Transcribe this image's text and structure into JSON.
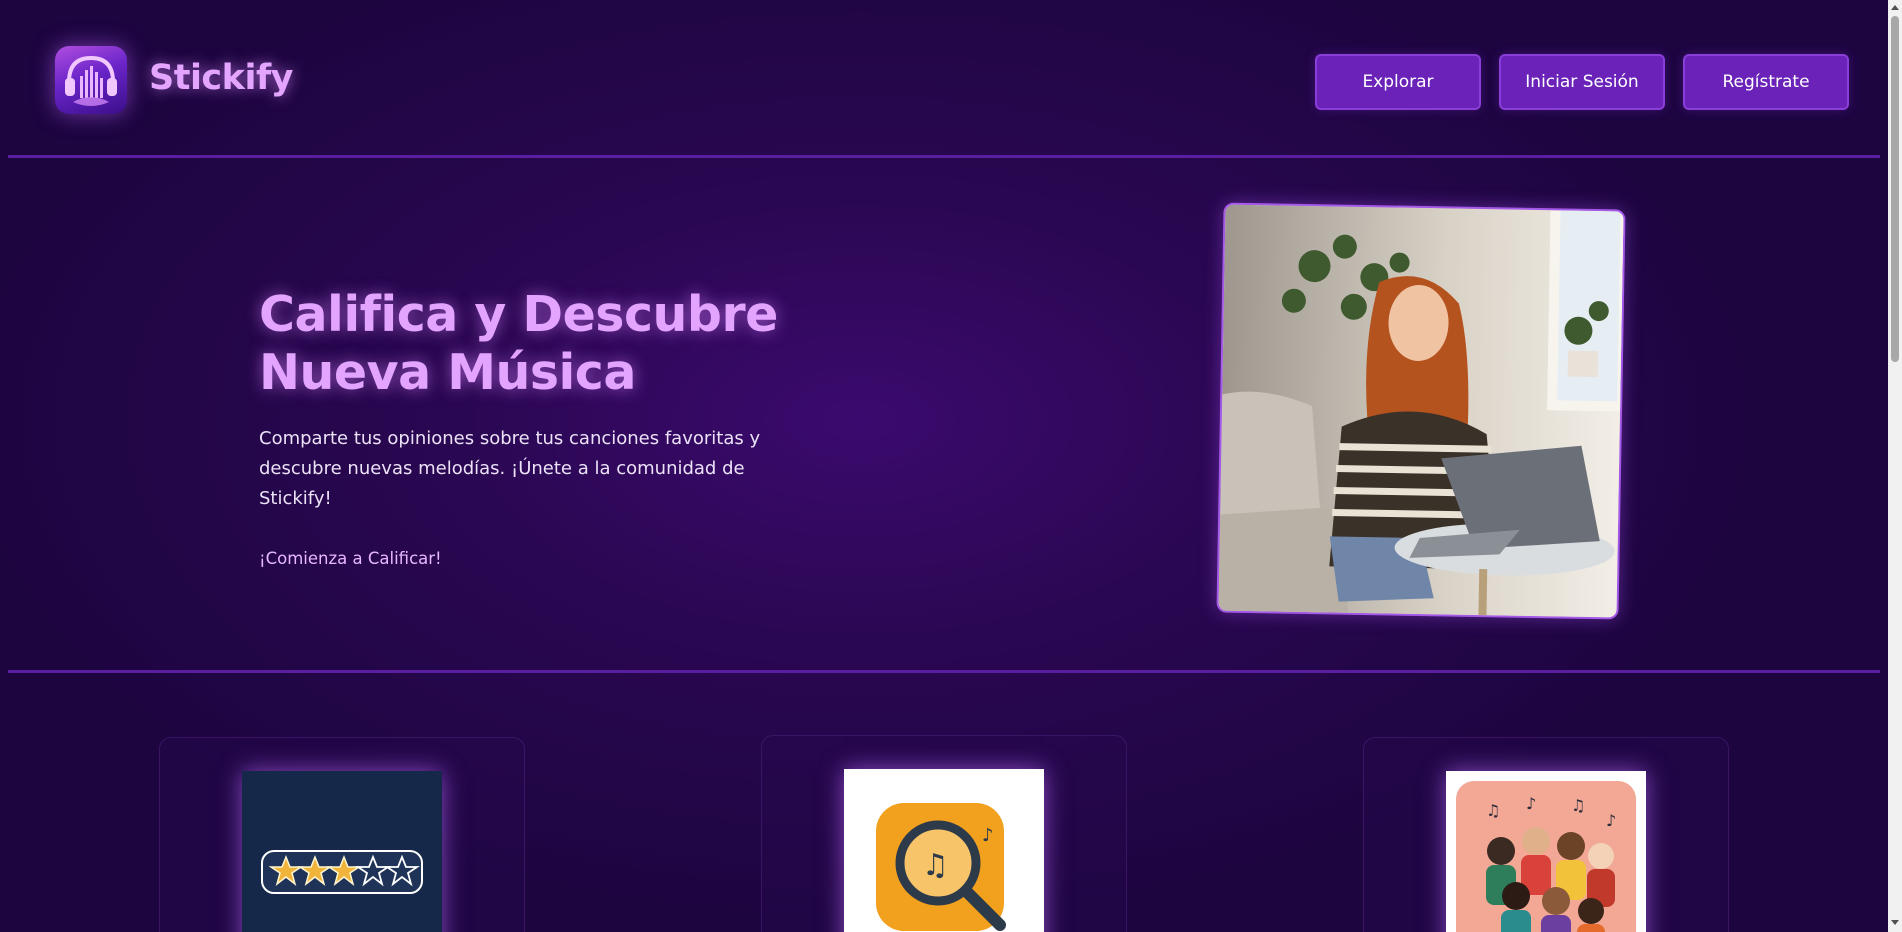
{
  "header": {
    "brand": "Stickify",
    "nav": {
      "explore": "Explorar",
      "login": "Iniciar Sesión",
      "register": "Regístrate"
    }
  },
  "hero": {
    "title_line1": "Califica y Descubre",
    "title_line2": "Nueva Música",
    "description": "Comparte tus opiniones sobre tus canciones favoritas y descubre nuevas melodías. ¡Únete a la comunidad de Stickify!",
    "cta": "¡Comienza a Calificar!"
  },
  "features": [
    {
      "icon": "star-rating-icon",
      "rating": 3,
      "max": 5
    },
    {
      "icon": "music-search-icon"
    },
    {
      "icon": "community-icon"
    }
  ],
  "colors": {
    "background": "#200640",
    "accent": "#e2a4ff",
    "button": "#6a22b8",
    "divider": "#5a1ea0"
  }
}
